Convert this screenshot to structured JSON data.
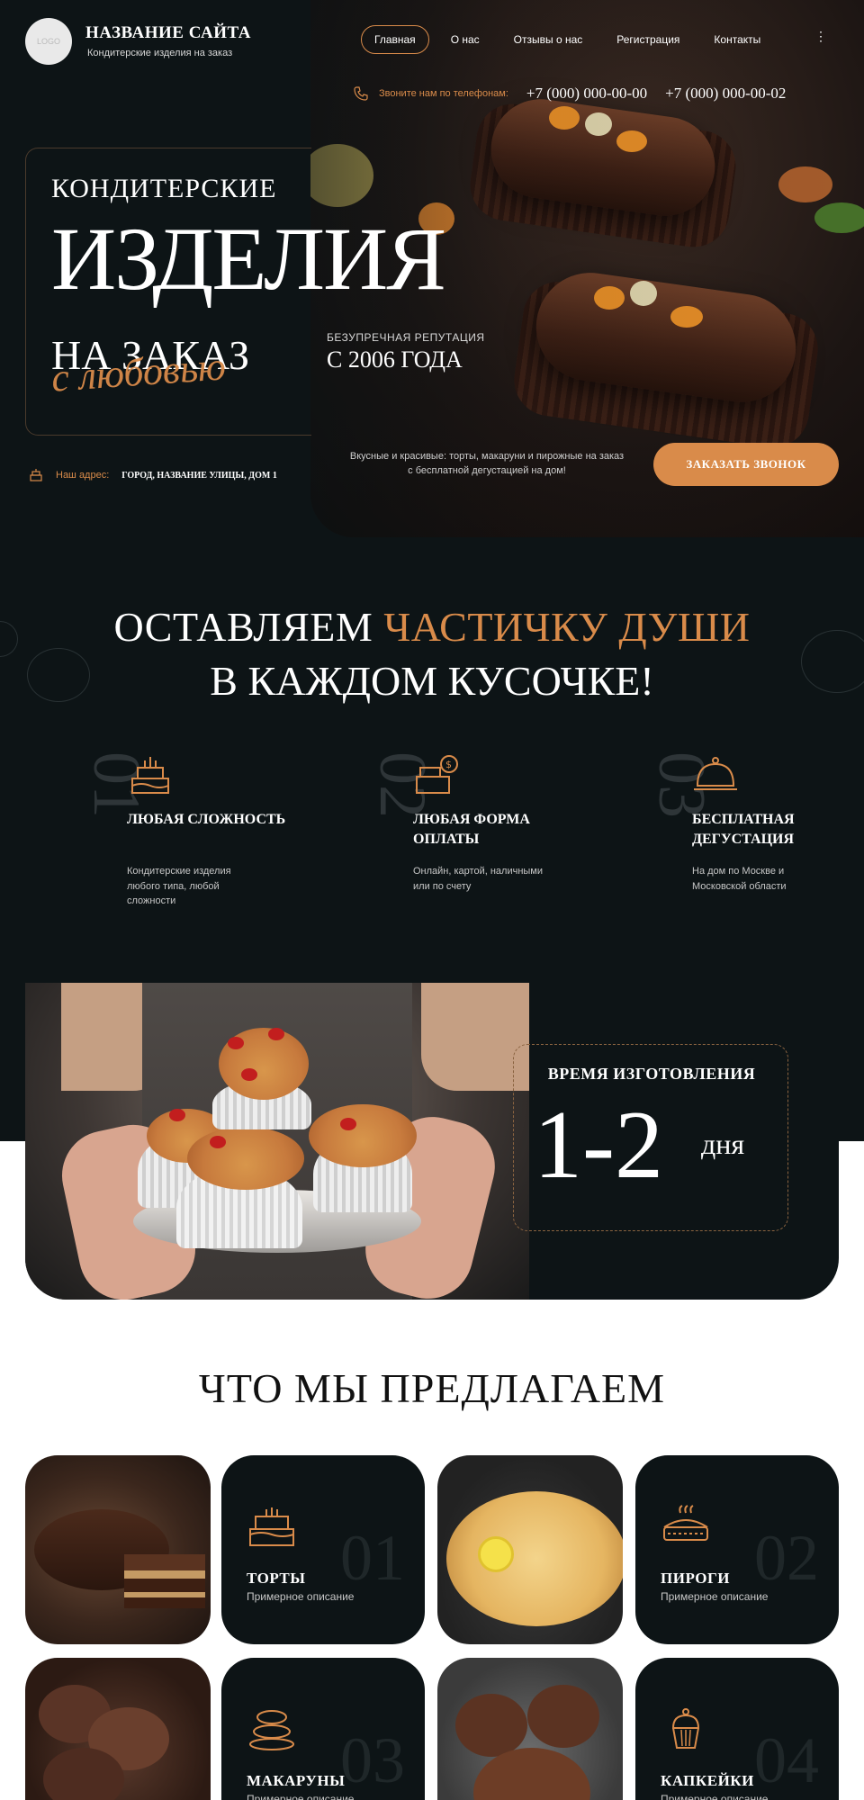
{
  "header": {
    "logo_text": "LOGO",
    "site_title": "НАЗВАНИЕ САЙТА",
    "site_subtitle": "Кондитерские изделия на заказ",
    "nav": [
      "Главная",
      "О нас",
      "Отзывы о нас",
      "Регистрация",
      "Контакты"
    ],
    "nav_more": "⋮",
    "phone_label": "Звоните нам по телефонам:",
    "phones": [
      "+7 (000) 000-00-00",
      "+7 (000) 000-00-02"
    ]
  },
  "hero": {
    "line1": "КОНДИТЕРСКИЕ",
    "line2": "ИЗДЕЛИЯ",
    "line3": "НА ЗАКАЗ",
    "script": "с любовью",
    "reputation_label": "БЕЗУПРЕЧНАЯ РЕПУТАЦИЯ",
    "reputation_value": "С 2006 ГОДА",
    "description": "Вкусные и красивые: торты, макаруни и пирожные на заказ с бесплатной дегустацией на дом!",
    "cta": "ЗАКАЗАТЬ ЗВОНОК",
    "address_label": "Наш адрес:",
    "address_value": "ГОРОД, НАЗВАНИЕ УЛИЦЫ, ДОМ 1"
  },
  "slogan": {
    "part1": "ОСТАВЛЯЕМ ",
    "accent": "ЧАСТИЧКУ ДУШИ",
    "line2": "В КАЖДОМ КУСОЧКЕ!"
  },
  "features": [
    {
      "num": "01",
      "title": "ЛЮБАЯ СЛОЖНОСТЬ",
      "desc": "Кондитерские изделия любого типа, любой сложности",
      "icon": "cake-icon"
    },
    {
      "num": "02",
      "title": "ЛЮБАЯ ФОРМА ОПЛАТЫ",
      "desc": "Онлайн, картой, наличными или по счету",
      "icon": "cash-register-icon"
    },
    {
      "num": "03",
      "title": "БЕСПЛАТНАЯ ДЕГУСТАЦИЯ",
      "desc": "На дом по Москве и Московской области",
      "icon": "cloche-icon"
    }
  ],
  "production_time": {
    "label": "ВРЕМЯ ИЗГОТОВЛЕНИЯ",
    "value": "1-2",
    "unit": "дня"
  },
  "offers": {
    "title": "ЧТО МЫ ПРЕДЛАГАЕМ",
    "items": [
      {
        "num": "01",
        "title": "ТОРТЫ",
        "desc": "Примерное описание",
        "icon": "cake-icon"
      },
      {
        "num": "02",
        "title": "ПИРОГИ",
        "desc": "Примерное описание",
        "icon": "pie-icon"
      },
      {
        "num": "03",
        "title": "МАКАРУНЫ",
        "desc": "Примерное описание",
        "icon": "macaron-icon"
      },
      {
        "num": "04",
        "title": "КАПКЕЙКИ",
        "desc": "Примерное описание",
        "icon": "cupcake-icon"
      }
    ]
  },
  "colors": {
    "accent": "#d98b4a",
    "dark": "#0d1416",
    "light": "#ffffff"
  }
}
